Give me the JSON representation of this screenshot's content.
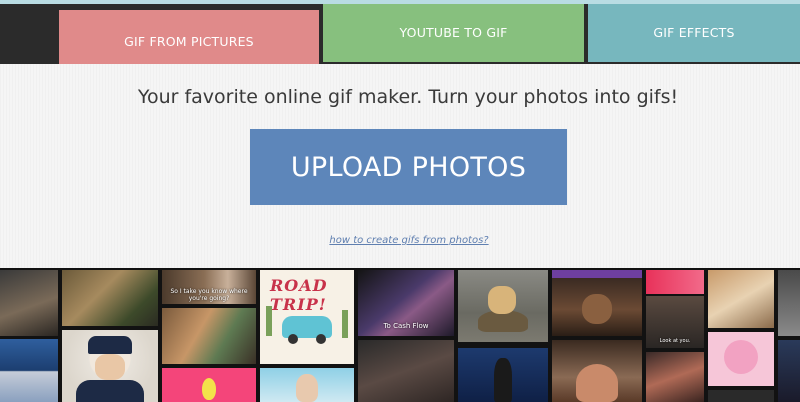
{
  "nav": {
    "tabs": [
      {
        "label": "GIF FROM PICTURES"
      },
      {
        "label": "YOUTUBE TO GIF"
      },
      {
        "label": "GIF EFFECTS"
      }
    ]
  },
  "main": {
    "tagline": "Your favorite online gif maker. Turn your photos into gifs!",
    "upload_label": "UPLOAD PHOTOS",
    "howto_link": "how to create gifs from photos?"
  },
  "gallery": {
    "captions": {
      "ricky": "So I take you know where you're going?",
      "road_trip": "ROAD TRIP!",
      "cash_flow": "To Cash Flow",
      "small": "Look at you."
    }
  },
  "colors": {
    "tab_active": "#e08a8a",
    "tab_youtube": "#87c07e",
    "tab_effects": "#77b7be",
    "upload_button": "#5d86ba",
    "link": "#5f7fb0"
  }
}
